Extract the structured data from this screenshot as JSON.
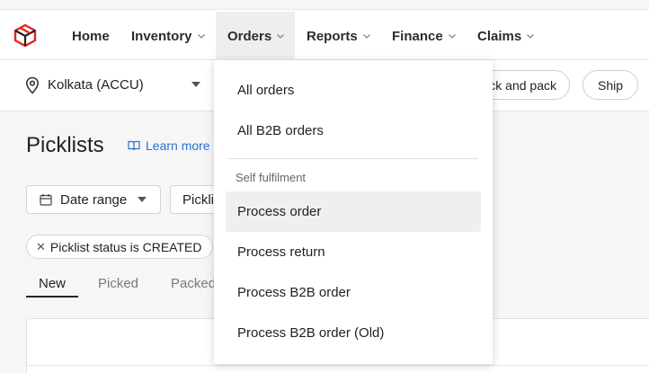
{
  "nav": {
    "items": [
      {
        "label": "Home",
        "chevron": false
      },
      {
        "label": "Inventory",
        "chevron": true
      },
      {
        "label": "Orders",
        "chevron": true
      },
      {
        "label": "Reports",
        "chevron": true
      },
      {
        "label": "Finance",
        "chevron": true
      },
      {
        "label": "Claims",
        "chevron": true
      }
    ],
    "active": "Orders",
    "brand_color": "#e02424"
  },
  "location": {
    "label": "Kolkata (ACCU)",
    "icon": "location-pin-icon"
  },
  "actions": {
    "pick_pack_label": "ck and pack",
    "ship_label": "Ship"
  },
  "page": {
    "title": "Picklists",
    "learn_more": "Learn more",
    "link_color": "#2a6fd6"
  },
  "filters": {
    "date_range": "Date range",
    "picklist": "Pickli"
  },
  "chip": {
    "label": "Picklist status is CREATED"
  },
  "tabs": [
    {
      "label": "New",
      "active": true
    },
    {
      "label": "Picked",
      "active": false
    },
    {
      "label": "Packed",
      "active": false
    }
  ],
  "orders_menu": {
    "items": [
      {
        "label": "All orders"
      },
      {
        "label": "All B2B orders"
      }
    ],
    "section": "Self fulfilment",
    "section_items": [
      {
        "label": "Process order",
        "hovered": true
      },
      {
        "label": "Process return",
        "hovered": false
      },
      {
        "label": "Process B2B order",
        "hovered": false
      },
      {
        "label": "Process B2B order (Old)",
        "hovered": false
      }
    ]
  }
}
